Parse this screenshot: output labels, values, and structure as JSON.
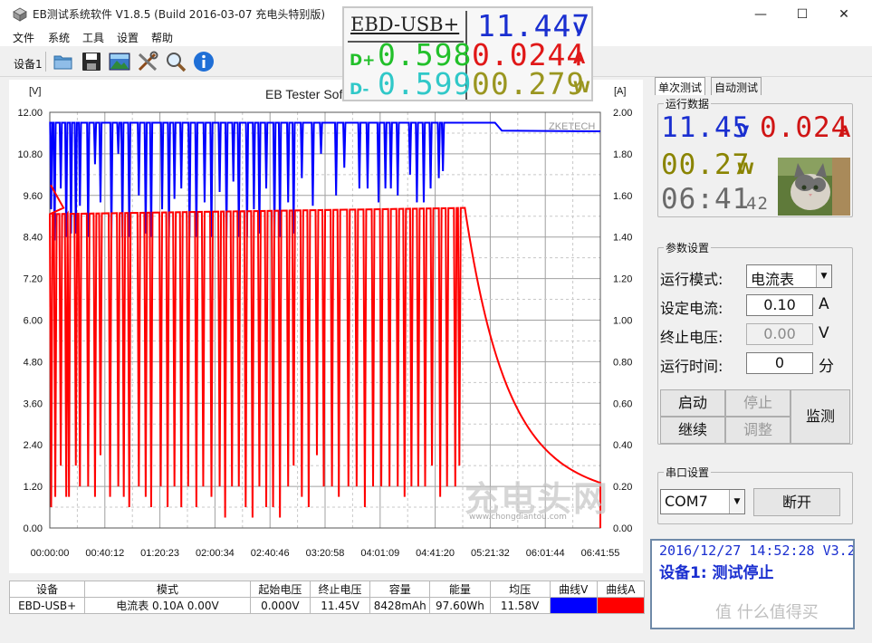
{
  "window": {
    "title": "EB测试系统软件 V1.8.5 (Build 2016-03-07 充电头特别版)",
    "minimize_glyph": "—",
    "maximize_glyph": "☐",
    "close_glyph": "✕"
  },
  "menu": [
    "文件",
    "系统",
    "工具",
    "设置",
    "帮助"
  ],
  "toolbar": {
    "device_label": "设备1",
    "icons": [
      "folder-icon",
      "save-icon",
      "image-icon",
      "tools-icon",
      "search-icon",
      "info-icon"
    ]
  },
  "lcd": {
    "device_name": "EBD-USB+",
    "voltage": "11.447",
    "voltage_unit": "V",
    "current": "0.0244",
    "current_unit": "A",
    "dplus_label": "D+",
    "dplus": "0.598",
    "dminus_label": "D-",
    "dminus": "0.599",
    "power": "00.279",
    "power_unit": "W",
    "colors": {
      "voltage": "#1a2fd0",
      "current": "#e01818",
      "dplus": "#22c02a",
      "dminus": "#30c8c8",
      "power": "#9a9620"
    }
  },
  "chart_data": {
    "type": "line",
    "title": "EB Tester Software",
    "watermark": "ZKETECH",
    "left_unit": "[V]",
    "right_unit": "[A]",
    "ylim_left": [
      0,
      12
    ],
    "ylim_right": [
      0,
      2
    ],
    "grid": true,
    "y_left_ticks": [
      "0.00",
      "1.20",
      "2.40",
      "3.60",
      "4.80",
      "6.00",
      "7.20",
      "8.40",
      "9.60",
      "10.80",
      "12.00"
    ],
    "y_right_ticks": [
      "0.00",
      "0.20",
      "0.40",
      "0.60",
      "0.80",
      "1.00",
      "1.20",
      "1.40",
      "1.60",
      "1.80",
      "2.00"
    ],
    "x_ticks": [
      "00:00:00",
      "00:40:12",
      "01:20:23",
      "02:00:34",
      "02:40:46",
      "03:20:58",
      "04:01:09",
      "04:41:20",
      "05:21:32",
      "06:01:44",
      "06:41:55"
    ],
    "series": [
      {
        "name": "曲线V",
        "color": "#0000ff",
        "axis": "left",
        "baseline": 11.7,
        "final": 11.45,
        "drop_end_time": "04:50:00",
        "step_time": "05:30:00",
        "dips": [
          [
            "00:01:00",
            9.2
          ],
          [
            "00:03:30",
            8.3
          ],
          [
            "00:08:00",
            9.8
          ],
          [
            "00:12:00",
            8.4
          ],
          [
            "00:15:30",
            8.5
          ],
          [
            "00:19:00",
            8.5
          ],
          [
            "00:22:00",
            9.3
          ],
          [
            "00:28:00",
            8.4
          ],
          [
            "00:33:00",
            10.5
          ],
          [
            "00:37:00",
            9.4
          ],
          [
            "00:45:00",
            8.4
          ],
          [
            "00:50:00",
            10.8
          ],
          [
            "00:53:00",
            8.4
          ],
          [
            "00:58:00",
            8.4
          ],
          [
            "01:05:00",
            9.6
          ],
          [
            "01:10:00",
            8.5
          ],
          [
            "01:14:00",
            8.4
          ],
          [
            "01:22:00",
            9.2
          ],
          [
            "01:27:00",
            8.4
          ],
          [
            "01:31:00",
            9.5
          ],
          [
            "01:36:00",
            9.8
          ],
          [
            "01:42:00",
            8.4
          ],
          [
            "01:47:00",
            8.4
          ],
          [
            "01:53:00",
            9.4
          ],
          [
            "01:58:00",
            8.4
          ],
          [
            "02:04:00",
            9.7
          ],
          [
            "02:09:00",
            8.4
          ],
          [
            "02:14:00",
            10.0
          ],
          [
            "02:18:00",
            8.4
          ],
          [
            "02:24:00",
            8.4
          ],
          [
            "02:29:00",
            9.2
          ],
          [
            "02:33:00",
            8.5
          ],
          [
            "02:38:00",
            9.8
          ],
          [
            "02:44:00",
            8.4
          ],
          [
            "02:48:00",
            8.4
          ],
          [
            "02:54:00",
            9.4
          ],
          [
            "02:58:00",
            8.5
          ],
          [
            "03:04:00",
            10.1
          ],
          [
            "03:12:00",
            9.3
          ],
          [
            "03:18:00",
            10.8
          ],
          [
            "03:29:00",
            9.6
          ],
          [
            "03:35:00",
            10.4
          ],
          [
            "03:46:00",
            9.8
          ],
          [
            "03:52:00",
            9.8
          ],
          [
            "04:00:00",
            9.4
          ],
          [
            "04:05:00",
            9.8
          ],
          [
            "04:09:00",
            9.8
          ],
          [
            "04:14:00",
            9.6
          ],
          [
            "04:23:00",
            10.2
          ],
          [
            "04:28:00",
            9.4
          ],
          [
            "04:33:00",
            9.4
          ],
          [
            "04:38:00",
            9.8
          ],
          [
            "04:44:00",
            10.1
          ],
          [
            "04:47:00",
            10.3
          ]
        ]
      },
      {
        "name": "曲线A",
        "color": "#ff0000",
        "axis": "right",
        "start": 1.65,
        "level_start": 1.51,
        "level_end": 1.54,
        "decay_start_time": "05:03:00",
        "end_time": "06:41:55",
        "end_value": 0.22,
        "dips": [
          [
            "00:01:00",
            0.1
          ],
          [
            "00:04:00",
            0.15
          ],
          [
            "00:08:00",
            0.3
          ],
          [
            "00:12:00",
            0.15
          ],
          [
            "00:14:00",
            0.15
          ],
          [
            "00:19:00",
            0.3
          ],
          [
            "00:22:00",
            0.2
          ],
          [
            "00:28:00",
            0.2
          ],
          [
            "00:33:00",
            0.15
          ],
          [
            "00:37:00",
            0.35
          ],
          [
            "00:44:00",
            0.15
          ],
          [
            "00:50:00",
            0.2
          ],
          [
            "00:54:00",
            0.15
          ],
          [
            "00:58:00",
            0.1
          ],
          [
            "01:05:00",
            0.2
          ],
          [
            "01:10:00",
            0.15
          ],
          [
            "01:14:00",
            0.1
          ],
          [
            "01:21:00",
            0.2
          ],
          [
            "01:26:00",
            0.1
          ],
          [
            "01:31:00",
            0.2
          ],
          [
            "01:36:00",
            0.1
          ],
          [
            "01:41:00",
            0.2
          ],
          [
            "01:47:00",
            0.1
          ],
          [
            "01:52:00",
            0.2
          ],
          [
            "01:58:00",
            0.15
          ],
          [
            "02:04:00",
            0.2
          ],
          [
            "02:08:00",
            0.05
          ],
          [
            "02:13:00",
            0.2
          ],
          [
            "02:18:00",
            0.2
          ],
          [
            "02:23:00",
            0.1
          ],
          [
            "02:28:00",
            0.05
          ],
          [
            "02:33:00",
            0.2
          ],
          [
            "02:38:00",
            0.1
          ],
          [
            "02:43:00",
            0.1
          ],
          [
            "02:48:00",
            0.05
          ],
          [
            "02:54:00",
            0.2
          ],
          [
            "02:58:00",
            0.3
          ],
          [
            "03:04:00",
            0.15
          ],
          [
            "03:09:00",
            0.1
          ],
          [
            "03:15:00",
            0.35
          ],
          [
            "03:20:00",
            0.2
          ],
          [
            "03:26:00",
            0.2
          ],
          [
            "03:31:00",
            0.15
          ],
          [
            "03:38:00",
            0.2
          ],
          [
            "03:44:00",
            0.2
          ],
          [
            "03:50:00",
            0.1
          ],
          [
            "03:56:00",
            0.2
          ],
          [
            "04:02:00",
            0.2
          ],
          [
            "04:08:00",
            0.2
          ],
          [
            "04:14:00",
            0.2
          ],
          [
            "04:19:00",
            0.15
          ],
          [
            "04:24:00",
            0.2
          ],
          [
            "04:29:00",
            0.2
          ],
          [
            "04:34:00",
            0.2
          ],
          [
            "04:39:00",
            0.3
          ],
          [
            "04:45:00",
            0.15
          ],
          [
            "04:50:00",
            0.2
          ],
          [
            "04:56:00",
            0.2
          ],
          [
            "04:59:00",
            0.3
          ]
        ]
      }
    ]
  },
  "right_panel": {
    "tabs": [
      "单次测试",
      "自动测试"
    ],
    "run_data": {
      "title": "运行数据",
      "voltage": "11.45",
      "voltage_unit": "V",
      "current": "0.024",
      "current_unit": "A",
      "power": "00.27",
      "power_unit": "W",
      "time_hm": "06:41",
      "time_s": "42",
      "colors": {
        "voltage": "#1a2fd0",
        "current": "#d01515",
        "power": "#8a8400",
        "time": "#6a6a6a"
      }
    },
    "params": {
      "title": "参数设置",
      "mode_label": "运行模式:",
      "mode_value": "电流表",
      "current_label": "设定电流:",
      "current_value": "0.10",
      "current_unit": "A",
      "stopv_label": "终止电压:",
      "stopv_value": "0.00",
      "stopv_unit": "V",
      "runtime_label": "运行时间:",
      "runtime_value": "0",
      "runtime_unit": "分",
      "buttons": {
        "start": "启动",
        "stop": "停止",
        "continue": "继续",
        "adjust": "调整",
        "monitor": "监测"
      }
    },
    "serial": {
      "title": "串口设置",
      "port": "COM7",
      "disconnect": "断开"
    },
    "status": {
      "line1": "2016/12/27 14:52:28  V3.20",
      "line2": "设备1: 测试停止"
    }
  },
  "table": {
    "headers": [
      "设备",
      "模式",
      "起始电压",
      "终止电压",
      "容量",
      "能量",
      "均压",
      "曲线V",
      "曲线A"
    ],
    "row": [
      "EBD-USB+",
      "电流表  0.10A  0.00V",
      "0.000V",
      "11.45V",
      "8428mAh",
      "97.60Wh",
      "11.58V",
      "",
      ""
    ],
    "curve_colors": [
      "#0000ff",
      "#ff0000"
    ]
  },
  "overlays": {
    "chongdiantou_watermark": "充电头网",
    "chongdiantou_url": "www.chongdiantou.com",
    "smzdm_watermark": "值 什么值得买"
  }
}
